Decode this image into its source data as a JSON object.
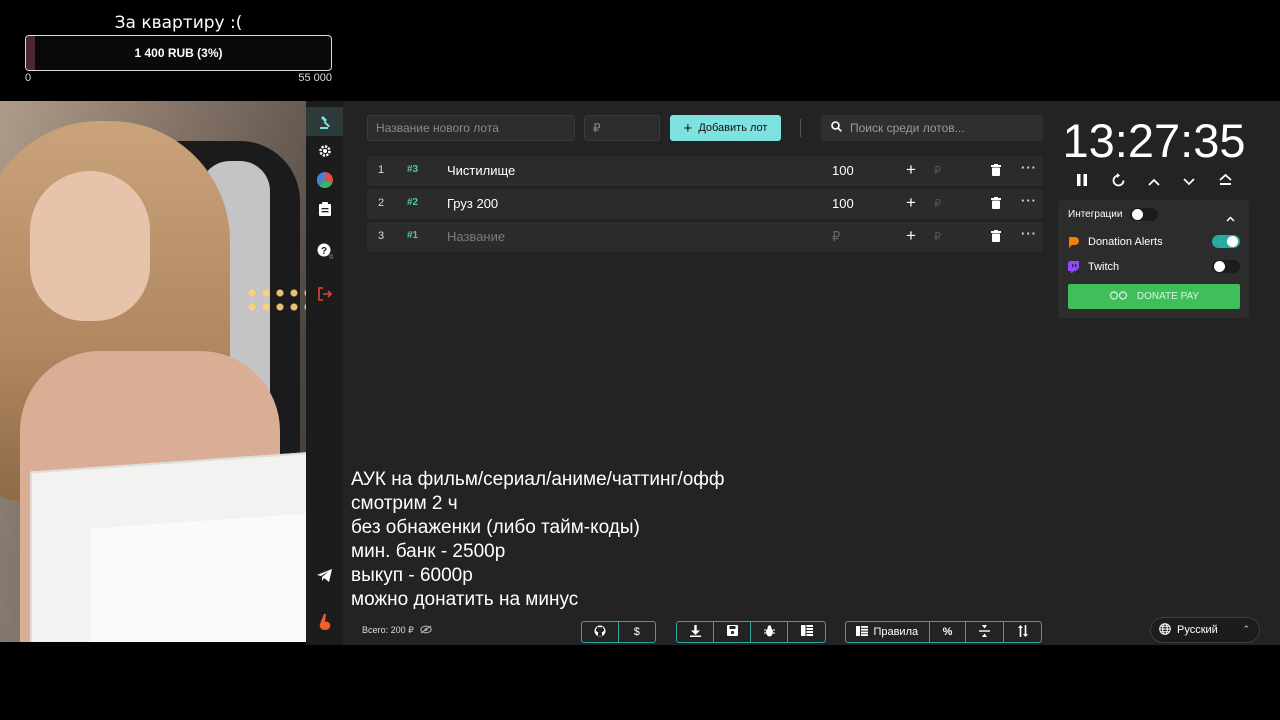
{
  "goal": {
    "title": "За квартиру :(",
    "progress_text": "1 400 RUB (3%)",
    "progress_fraction": 0.03,
    "min": "0",
    "max": "55 000"
  },
  "form": {
    "lot_name_placeholder": "Название нового лота",
    "amount_placeholder": "₽",
    "add_button": "Добавить лот",
    "search_placeholder": "Поиск среди лотов..."
  },
  "lots": [
    {
      "index": "1",
      "id": "#3",
      "name": "Чистилище",
      "amount": "100",
      "rub": "₽"
    },
    {
      "index": "2",
      "id": "#2",
      "name": "Груз 200",
      "amount": "100",
      "rub": "₽"
    },
    {
      "index": "3",
      "id": "#1",
      "name": "Название",
      "amount": "₽",
      "rub": "₽"
    }
  ],
  "timer": {
    "value": "13:27:35"
  },
  "integrations": {
    "title": "Интеграции",
    "donation_alerts": "Donation Alerts",
    "twitch": "Twitch",
    "donatepay": "DONATE PAY"
  },
  "rules": [
    "АУК на фильм/сериал/аниме/чаттинг/офф",
    "смотрим 2 ч",
    "без обнаженки (либо тайм-коды)",
    "мин. банк - 2500р",
    "выкуп - 6000р",
    "можно донатить на минус"
  ],
  "bottom": {
    "total": "Всего: 200 ₽",
    "rules_button": "Правила",
    "language": "Русский"
  },
  "colors": {
    "accent": "#7ee2e0",
    "teal": "#2aa9a3",
    "donatepay": "#3fbe5a",
    "logout": "#e0443a"
  }
}
